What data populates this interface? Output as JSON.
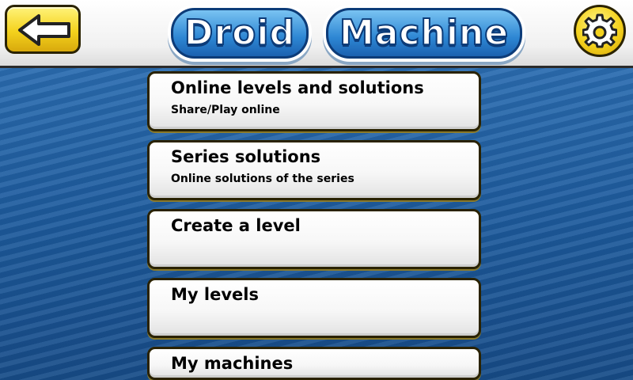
{
  "header": {
    "title_words": [
      "Droid",
      "Machine"
    ]
  },
  "menu": {
    "items": [
      {
        "title": "Online levels and solutions",
        "subtitle": "Share/Play online"
      },
      {
        "title": "Series solutions",
        "subtitle": "Online solutions of the series"
      },
      {
        "title": "Create a level",
        "subtitle": ""
      },
      {
        "title": "My levels",
        "subtitle": ""
      },
      {
        "title": "My machines",
        "subtitle": ""
      }
    ]
  },
  "icons": {
    "back": "arrow-left-icon",
    "settings": "gear-icon"
  },
  "colors": {
    "accent_yellow": "#f4d21d",
    "background_blue": "#1f5a9a",
    "title_blue": "#2d86d3"
  }
}
